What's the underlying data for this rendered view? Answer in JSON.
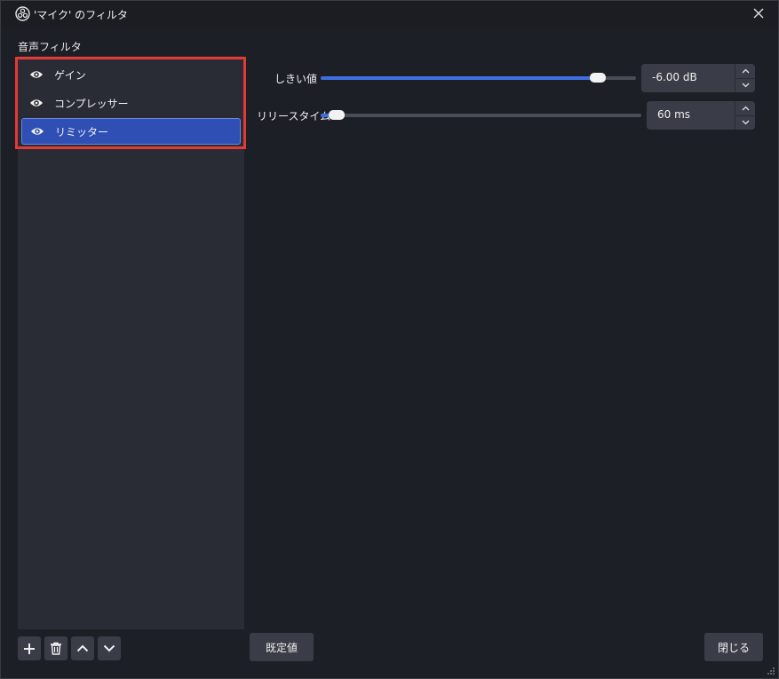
{
  "window": {
    "title": "'マイク' のフィルタ"
  },
  "filters": {
    "section_label": "音声フィルタ",
    "items": [
      {
        "label": "ゲイン",
        "visible": true,
        "selected": false
      },
      {
        "label": "コンプレッサー",
        "visible": true,
        "selected": false
      },
      {
        "label": "リミッター",
        "visible": true,
        "selected": true
      }
    ]
  },
  "properties": {
    "threshold": {
      "label": "しきい値",
      "value_text": "-6.00 dB",
      "slider_fraction": 0.88
    },
    "release_time": {
      "label": "リリースタイム",
      "value_text": "60 ms",
      "slider_fraction": 0.05
    }
  },
  "toolbar": {
    "add_icon": "plus-icon",
    "remove_icon": "trash-icon",
    "move_up_icon": "chevron-up-icon",
    "move_down_icon": "chevron-down-icon"
  },
  "buttons": {
    "defaults_label": "既定値",
    "close_label": "閉じる"
  },
  "colors": {
    "accent": "#3d6fe0",
    "selected_bg": "#2f4fb5",
    "highlight": "#e53935"
  }
}
